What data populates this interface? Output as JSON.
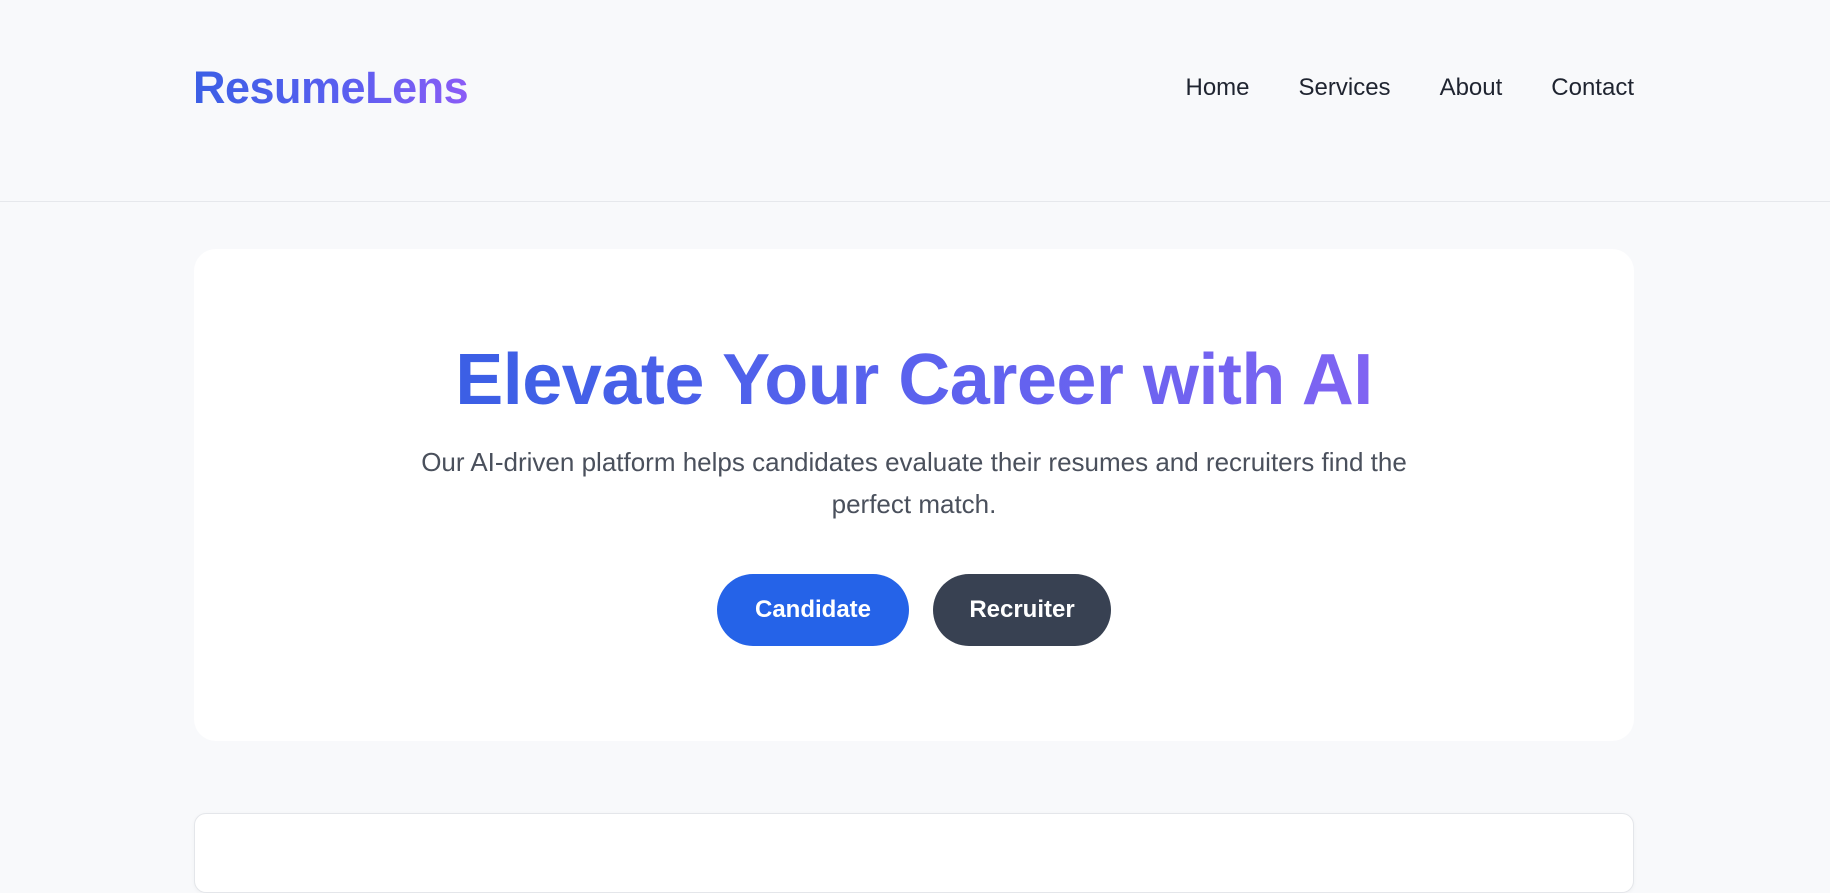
{
  "header": {
    "logo": "ResumeLens",
    "nav": [
      "Home",
      "Services",
      "About",
      "Contact"
    ]
  },
  "hero": {
    "title": "Elevate Your Career with AI",
    "subtitle": "Our AI-driven platform helps candidates evaluate their resumes and recruiters find the perfect match.",
    "buttons": {
      "candidate": "Candidate",
      "recruiter": "Recruiter"
    }
  },
  "colors": {
    "primary": "#2563e8",
    "secondary": "#384152",
    "gradient_start": "#3b5fe5",
    "gradient_end": "#8b5cf6"
  }
}
